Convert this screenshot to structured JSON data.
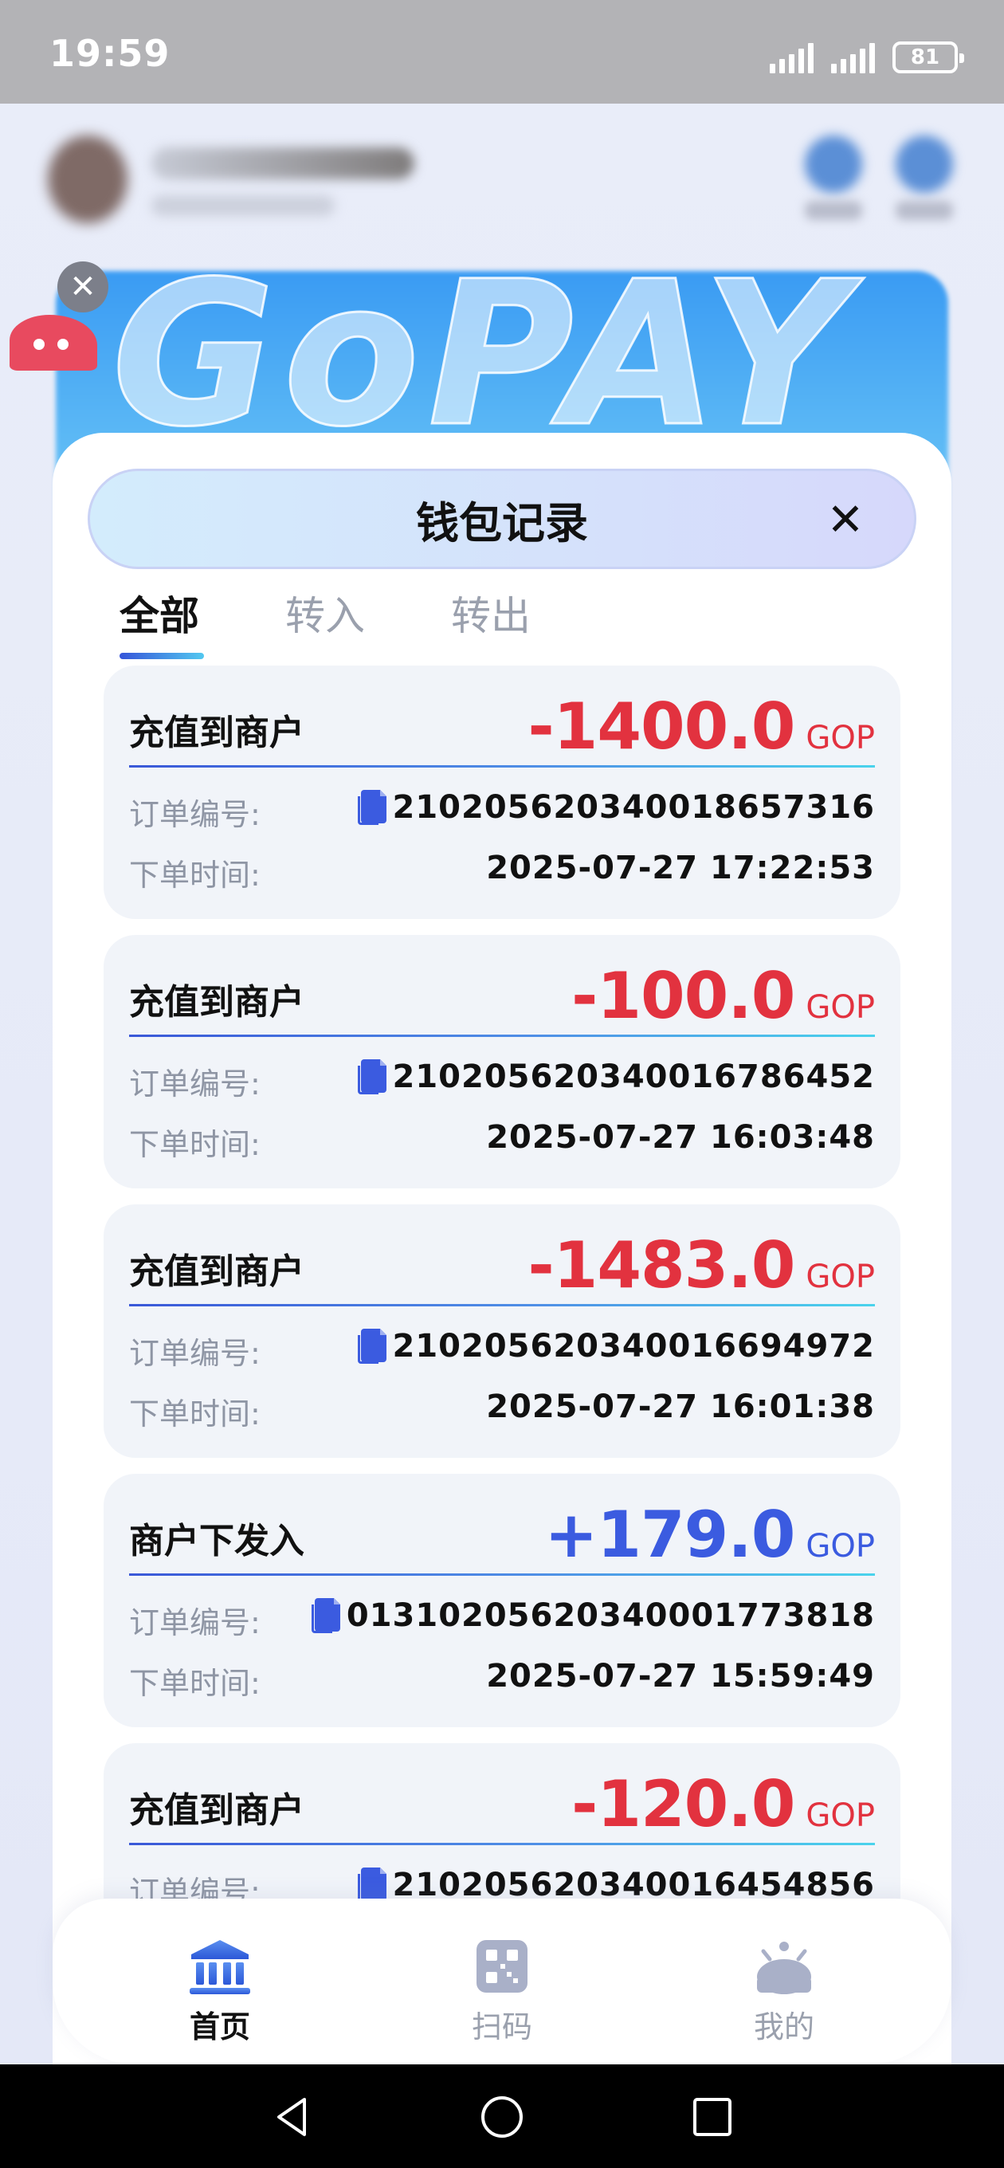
{
  "status_bar": {
    "time": "19:59",
    "battery": "81"
  },
  "modal": {
    "title": "钱包记录",
    "tabs": [
      {
        "label": "全部",
        "active": true
      },
      {
        "label": "转入",
        "active": false
      },
      {
        "label": "转出",
        "active": false
      }
    ],
    "order_no_label": "订单编号:",
    "order_time_label": "下单时间:",
    "records": [
      {
        "title": "充值到商户",
        "amount": "-1400.0",
        "unit": "GOP",
        "sign": "negative",
        "order_no": "210205620340018657316",
        "order_time": "2025-07-27 17:22:53"
      },
      {
        "title": "充值到商户",
        "amount": "-100.0",
        "unit": "GOP",
        "sign": "negative",
        "order_no": "210205620340016786452",
        "order_time": "2025-07-27 16:03:48"
      },
      {
        "title": "充值到商户",
        "amount": "-1483.0",
        "unit": "GOP",
        "sign": "negative",
        "order_no": "210205620340016694972",
        "order_time": "2025-07-27 16:01:38"
      },
      {
        "title": "商户下发入",
        "amount": "+179.0",
        "unit": "GOP",
        "sign": "positive",
        "order_no": "01310205620340001773818",
        "order_time": "2025-07-27 15:59:49"
      },
      {
        "title": "充值到商户",
        "amount": "-120.0",
        "unit": "GOP",
        "sign": "negative",
        "order_no": "210205620340016454856",
        "order_time": ""
      }
    ]
  },
  "background": {
    "banner_text": "GoPAY"
  },
  "bottom_nav": {
    "items": [
      {
        "label": "首页",
        "icon": "bank-icon",
        "active": true
      },
      {
        "label": "扫码",
        "icon": "qr-scan-icon",
        "active": false
      },
      {
        "label": "我的",
        "icon": "profile-icon",
        "active": false
      }
    ]
  },
  "colors": {
    "negative": "#e2323f",
    "positive": "#3b5be0",
    "accent": "#3554d9"
  }
}
